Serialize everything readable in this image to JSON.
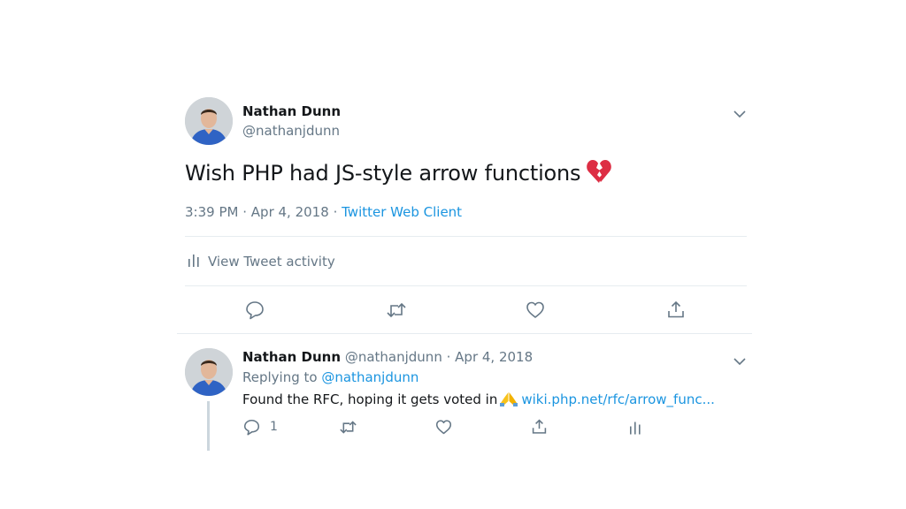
{
  "main_tweet": {
    "author_name": "Nathan Dunn",
    "author_handle": "@nathanjdunn",
    "text": "Wish PHP had JS-style arrow functions",
    "emoji": "broken-heart-emoji",
    "time": "3:39 PM",
    "sep1": "·",
    "date": "Apr 4, 2018",
    "sep2": "·",
    "client": "Twitter Web Client",
    "activity_label": "View Tweet activity",
    "actions": [
      "reply-icon",
      "retweet-icon",
      "like-icon",
      "share-icon"
    ]
  },
  "reply_tweet": {
    "author_name": "Nathan Dunn",
    "author_handle": "@nathanjdunn",
    "sep": "·",
    "date": "Apr 4, 2018",
    "replying_prefix": "Replying to",
    "replying_to": "@nathanjdunn",
    "text": "Found the RFC, hoping it gets voted in",
    "emoji": "folded-hands-emoji",
    "link": "wiki.php.net/rfc/arrow_func...",
    "reply_count": "1",
    "actions": [
      "reply-icon",
      "retweet-icon",
      "like-icon",
      "share-icon",
      "analytics-icon"
    ]
  },
  "colors": {
    "link": "#1b95e0",
    "secondary_text": "#657786",
    "divider": "#e6ecf0",
    "thread_line": "#ccd6dd"
  }
}
